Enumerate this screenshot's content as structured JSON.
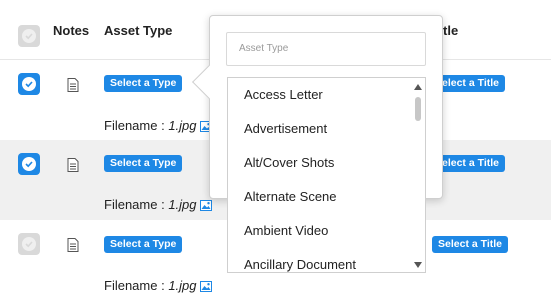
{
  "header": {
    "notes": "Notes",
    "asset_type": "Asset Type",
    "title_partial": "tle"
  },
  "rows": [
    {
      "type_button": "Select a Type",
      "title_button": "elect a Title",
      "filename_label": "Filename :",
      "filename_value": "1.jpg"
    },
    {
      "type_button": "Select a Type",
      "title_button": "elect a Title",
      "filename_label": "Filename :",
      "filename_value": "1.jpg"
    },
    {
      "type_button": "Select a Type",
      "title_button": "Select a Title",
      "filename_label": "Filename :",
      "filename_value": "1.jpg"
    }
  ],
  "dropdown": {
    "placeholder": "Asset Type",
    "options": [
      "Access Letter",
      "Advertisement",
      "Alt/Cover Shots",
      "Alternate Scene",
      "Ambient Video",
      "Ancillary Document"
    ]
  },
  "colors": {
    "accent": "#1e88e5",
    "row_shade": "#f0f0f0"
  }
}
